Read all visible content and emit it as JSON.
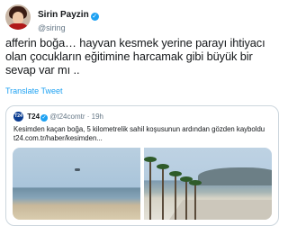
{
  "author": {
    "display_name": "Sirin Payzin",
    "handle": "@siring",
    "verified_mark": "✓"
  },
  "tweet": {
    "text": "afferin boğa… hayvan kesmek yerine parayı ihtiyacı olan çocukların eğitimine harcamak gibi büyük bir sevap var mı ..",
    "translate_label": "Translate Tweet"
  },
  "quoted": {
    "logo_text": "T24",
    "name": "T24",
    "verified_mark": "✓",
    "handle": "@t24comtr",
    "separator": "·",
    "time": "19h",
    "text": "Kesimden kaçan boğa, 5 kilometrelik sahil koşusunun ardından gözden kayboldu",
    "link": "t24.com.tr/haber/kesimden..."
  },
  "colors": {
    "link": "#1da1f2",
    "secondary_text": "#657786",
    "border": "#ccd6dd"
  }
}
